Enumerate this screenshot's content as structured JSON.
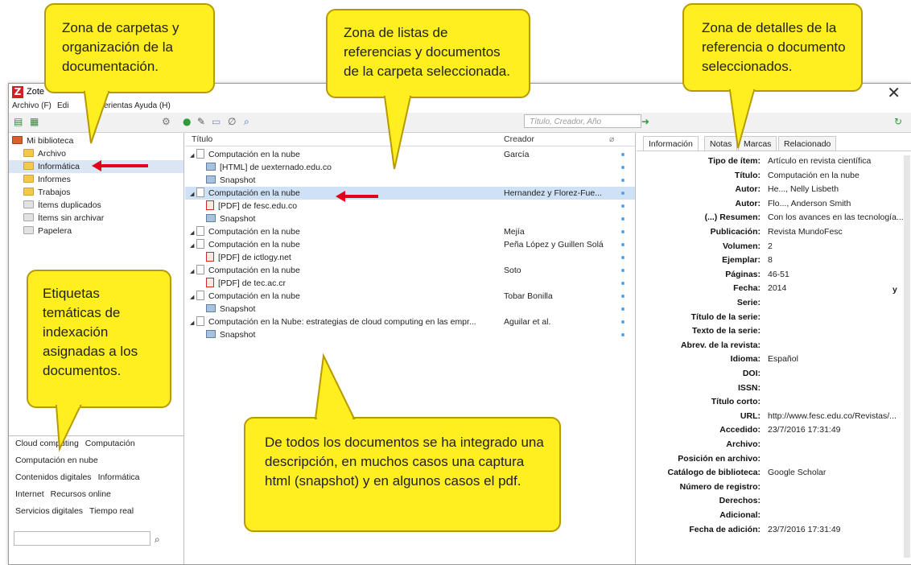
{
  "window": {
    "title": "Zote",
    "close_glyph": "✕"
  },
  "menubar": {
    "items": [
      "Archivo (F)",
      "Edi",
      "erientas",
      "Ayuda (H)"
    ]
  },
  "toolbar": {
    "search_placeholder": "Título, Creador, Año"
  },
  "collections": [
    {
      "label": "Mi biblioteca",
      "icon": "library-icon",
      "selected": false
    },
    {
      "label": "Archivo",
      "icon": "folder-icon",
      "selected": false
    },
    {
      "label": "Informática",
      "icon": "folder-icon",
      "selected": true
    },
    {
      "label": "Informes",
      "icon": "folder-icon",
      "selected": false
    },
    {
      "label": "Trabajos",
      "icon": "folder-icon",
      "selected": false
    },
    {
      "label": "Ítems duplicados",
      "icon": "duplicates-icon",
      "selected": false
    },
    {
      "label": "Ítems sin archivar",
      "icon": "unfiled-icon",
      "selected": false
    },
    {
      "label": "Papelera",
      "icon": "trash-icon",
      "selected": false
    }
  ],
  "tags": [
    [
      "Cloud computing",
      "Computación"
    ],
    [
      "Computación en nube"
    ],
    [
      "Contenidos digitales",
      "Informática"
    ],
    [
      "Internet",
      "Recursos online"
    ],
    [
      "Servicios digitales",
      "Tiempo real"
    ]
  ],
  "items_columns": {
    "title": "Título",
    "creator": "Creador"
  },
  "items": [
    {
      "title": "Computación en la nube",
      "creator": "García",
      "type": "doc",
      "child": false,
      "selected": false
    },
    {
      "title": "[HTML] de uexternado.edu.co",
      "creator": "",
      "type": "snap",
      "child": true,
      "selected": false
    },
    {
      "title": "Snapshot",
      "creator": "",
      "type": "snap",
      "child": true,
      "selected": false
    },
    {
      "title": "Computación en la nube",
      "creator": "Hernandez y Florez-Fue...",
      "type": "doc",
      "child": false,
      "selected": true
    },
    {
      "title": "[PDF] de fesc.edu.co",
      "creator": "",
      "type": "pdf",
      "child": true,
      "selected": false
    },
    {
      "title": "Snapshot",
      "creator": "",
      "type": "snap",
      "child": true,
      "selected": false
    },
    {
      "title": "Computación en la nube",
      "creator": "Mejía",
      "type": "doc",
      "child": false,
      "selected": false
    },
    {
      "title": "Computación en la nube",
      "creator": "Peña López y Guillen Solá",
      "type": "doc",
      "child": false,
      "selected": false
    },
    {
      "title": "[PDF] de ictlogy.net",
      "creator": "",
      "type": "pdf",
      "child": true,
      "selected": false
    },
    {
      "title": "Computación en la nube",
      "creator": "Soto",
      "type": "doc",
      "child": false,
      "selected": false
    },
    {
      "title": "[PDF] de tec.ac.cr",
      "creator": "",
      "type": "pdf",
      "child": true,
      "selected": false
    },
    {
      "title": "Computación en la nube",
      "creator": "Tobar Bonilla",
      "type": "doc",
      "child": false,
      "selected": false
    },
    {
      "title": "Snapshot",
      "creator": "",
      "type": "snap",
      "child": true,
      "selected": false
    },
    {
      "title": "Computación en la Nube: estrategias de cloud computing en las empr...",
      "creator": "Aguilar et al.",
      "type": "doc",
      "child": false,
      "selected": false
    },
    {
      "title": "Snapshot",
      "creator": "",
      "type": "snap",
      "child": true,
      "selected": false
    }
  ],
  "detail_tabs": [
    "Información",
    "Notas",
    "Marcas",
    "Relacionado"
  ],
  "fields": [
    {
      "label": "Tipo de ítem:",
      "value": "Artículo en revista científica"
    },
    {
      "label": "Título:",
      "value": "Computación en la nube"
    },
    {
      "label": "Autor:",
      "value": "He..., Nelly Lisbeth"
    },
    {
      "label": "Autor:",
      "value": "Flo..., Anderson Smith"
    },
    {
      "label": "(...) Resumen:",
      "value": "Con los avances en las tecnología..."
    },
    {
      "label": "Publicación:",
      "value": "Revista MundoFesc"
    },
    {
      "label": "Volumen:",
      "value": "2"
    },
    {
      "label": "Ejemplar:",
      "value": "8"
    },
    {
      "label": "Páginas:",
      "value": "46-51"
    },
    {
      "label": "Fecha:",
      "value": "2014"
    },
    {
      "label": "Serie:",
      "value": ""
    },
    {
      "label": "Título de la serie:",
      "value": ""
    },
    {
      "label": "Texto de la serie:",
      "value": ""
    },
    {
      "label": "Abrev. de la revista:",
      "value": ""
    },
    {
      "label": "Idioma:",
      "value": "Español"
    },
    {
      "label": "DOI:",
      "value": ""
    },
    {
      "label": "ISSN:",
      "value": ""
    },
    {
      "label": "Título corto:",
      "value": ""
    },
    {
      "label": "URL:",
      "value": "http://www.fesc.edu.co/Revistas/..."
    },
    {
      "label": "Accedido:",
      "value": "23/7/2016 17:31:49"
    },
    {
      "label": "Archivo:",
      "value": ""
    },
    {
      "label": "Posición en archivo:",
      "value": ""
    },
    {
      "label": "Catálogo de biblioteca:",
      "value": "Google Scholar"
    },
    {
      "label": "Número de registro:",
      "value": ""
    },
    {
      "label": "Derechos:",
      "value": ""
    },
    {
      "label": "Adicional:",
      "value": ""
    },
    {
      "label": "Fecha de adición:",
      "value": "23/7/2016 17:31:49"
    }
  ],
  "date_flag": "y",
  "callouts": {
    "folders": "Zona de carpetas y organización de la documentación.",
    "lists": "Zona de listas de referencias y documentos de la carpeta seleccionada.",
    "details": "Zona de detalles de la referencia o documento seleccionados.",
    "tags": "Etiquetas temáticas de indexación asignadas a los documentos.",
    "snapshot": "De todos los documentos se ha integrado una descripción, en muchos casos una captura html (snapshot) y en algunos casos el pdf."
  },
  "colors": {
    "callout_fill": "#ffee20",
    "callout_border": "#b79a00",
    "arrow": "#e2001a",
    "selection": "#cfe1f5"
  }
}
